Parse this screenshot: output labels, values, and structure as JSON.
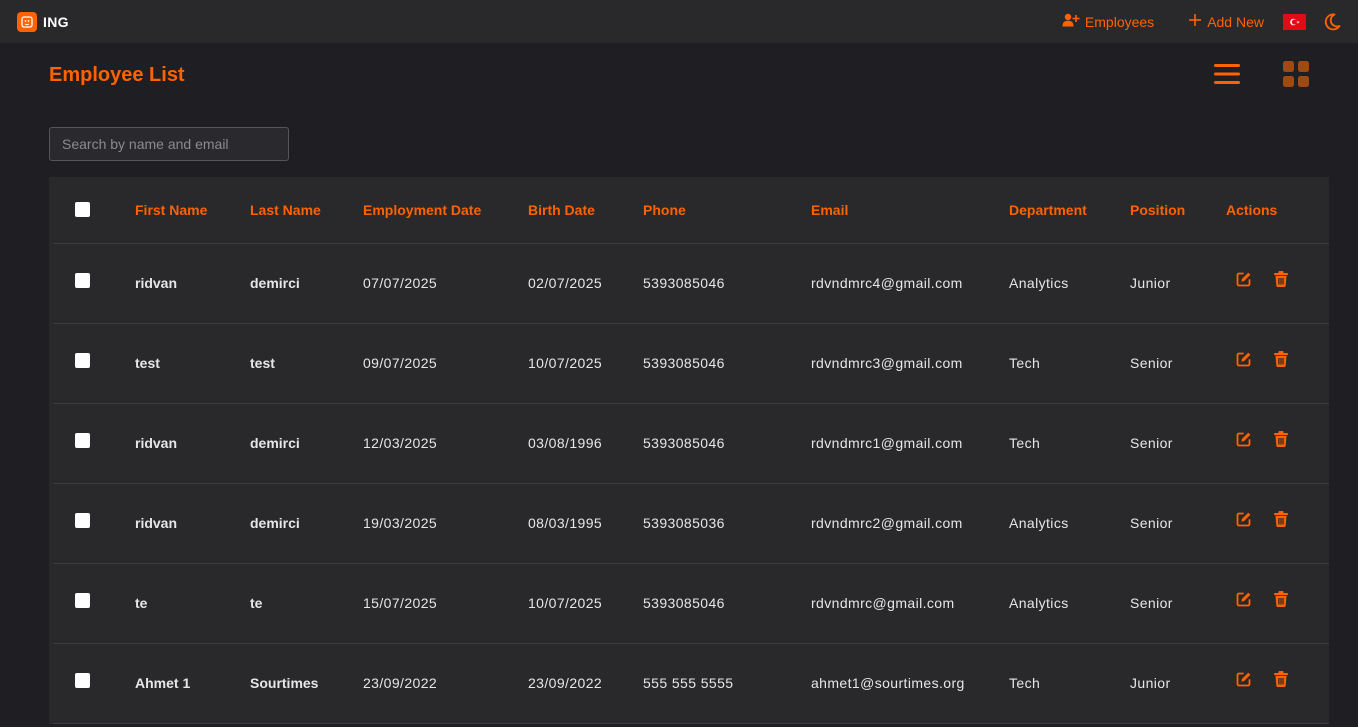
{
  "header": {
    "brand": "ING",
    "nav_employees": "Employees",
    "nav_add_new": "Add New"
  },
  "page": {
    "title": "Employee List"
  },
  "search": {
    "placeholder": "Search by name and email"
  },
  "table": {
    "columns": [
      "First Name",
      "Last Name",
      "Employment Date",
      "Birth Date",
      "Phone",
      "Email",
      "Department",
      "Position",
      "Actions"
    ],
    "rows": [
      {
        "first": "ridvan",
        "last": "demirci",
        "employment": "07/07/2025",
        "birth": "02/07/2025",
        "phone": "5393085046",
        "email": "rdvndmrc4@gmail.com",
        "department": "Analytics",
        "position": "Junior"
      },
      {
        "first": "test",
        "last": "test",
        "employment": "09/07/2025",
        "birth": "10/07/2025",
        "phone": "5393085046",
        "email": "rdvndmrc3@gmail.com",
        "department": "Tech",
        "position": "Senior"
      },
      {
        "first": "ridvan",
        "last": "demirci",
        "employment": "12/03/2025",
        "birth": "03/08/1996",
        "phone": "5393085046",
        "email": "rdvndmrc1@gmail.com",
        "department": "Tech",
        "position": "Senior"
      },
      {
        "first": "ridvan",
        "last": "demirci",
        "employment": "19/03/2025",
        "birth": "08/03/1995",
        "phone": "5393085036",
        "email": "rdvndmrc2@gmail.com",
        "department": "Analytics",
        "position": "Senior"
      },
      {
        "first": "te",
        "last": "te",
        "employment": "15/07/2025",
        "birth": "10/07/2025",
        "phone": "5393085046",
        "email": "rdvndmrc@gmail.com",
        "department": "Analytics",
        "position": "Senior"
      },
      {
        "first": "Ahmet 1",
        "last": "Sourtimes",
        "employment": "23/09/2022",
        "birth": "23/09/2022",
        "phone": "555 555 5555",
        "email": "ahmet1@sourtimes.org",
        "department": "Tech",
        "position": "Junior"
      }
    ]
  },
  "icons": {
    "logo": "lion-logo-icon",
    "employees": "user-plus-icon",
    "add_new": "plus-icon",
    "language": "turkey-flag-icon",
    "theme": "moon-icon",
    "list_view": "hamburger-list-icon",
    "grid_view": "grid-icon",
    "edit": "edit-icon",
    "delete": "trash-icon"
  },
  "colors": {
    "accent": "#ff6200",
    "background": "#1f1f23",
    "surface": "#29292c"
  }
}
